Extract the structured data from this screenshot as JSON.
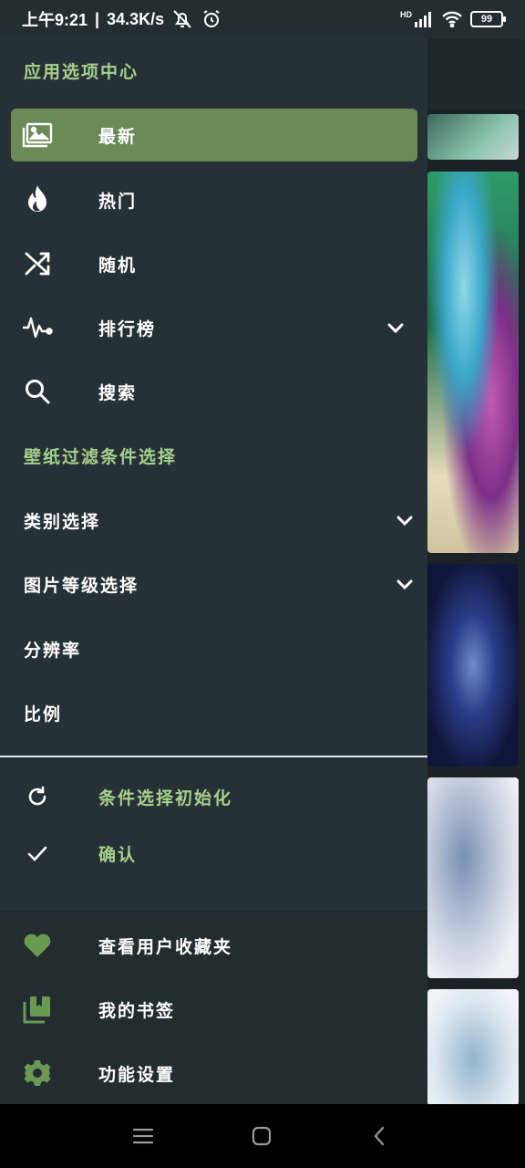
{
  "status_bar": {
    "time": "上午9:21",
    "separator": "|",
    "net_speed": "34.3K/s",
    "hd_label": "HD",
    "battery": "99"
  },
  "drawer": {
    "section_app": "应用选项中心",
    "nav_items": [
      {
        "label": "最新",
        "icon": "image-gallery-icon",
        "active": true
      },
      {
        "label": "热门",
        "icon": "flame-icon"
      },
      {
        "label": "随机",
        "icon": "shuffle-icon"
      },
      {
        "label": "排行榜",
        "icon": "pulse-chart-icon",
        "expandable": true
      },
      {
        "label": "搜索",
        "icon": "search-icon"
      }
    ],
    "section_filter": "壁纸过滤条件选择",
    "filter_items": [
      {
        "label": "类别选择",
        "expandable": true
      },
      {
        "label": "图片等级选择",
        "expandable": true
      },
      {
        "label": "分辨率"
      },
      {
        "label": "比例"
      }
    ],
    "actions": [
      {
        "label": "条件选择初始化",
        "icon": "refresh-icon"
      },
      {
        "label": "确认",
        "icon": "check-icon"
      }
    ],
    "footer_items": [
      {
        "label": "查看用户收藏夹",
        "icon": "heart-icon"
      },
      {
        "label": "我的书签",
        "icon": "bookmarks-icon"
      },
      {
        "label": "功能设置",
        "icon": "gear-icon"
      }
    ]
  },
  "colors": {
    "accent_green": "#a8d08d",
    "active_bg": "#6a8a56",
    "drawer_bg": "#263137"
  }
}
